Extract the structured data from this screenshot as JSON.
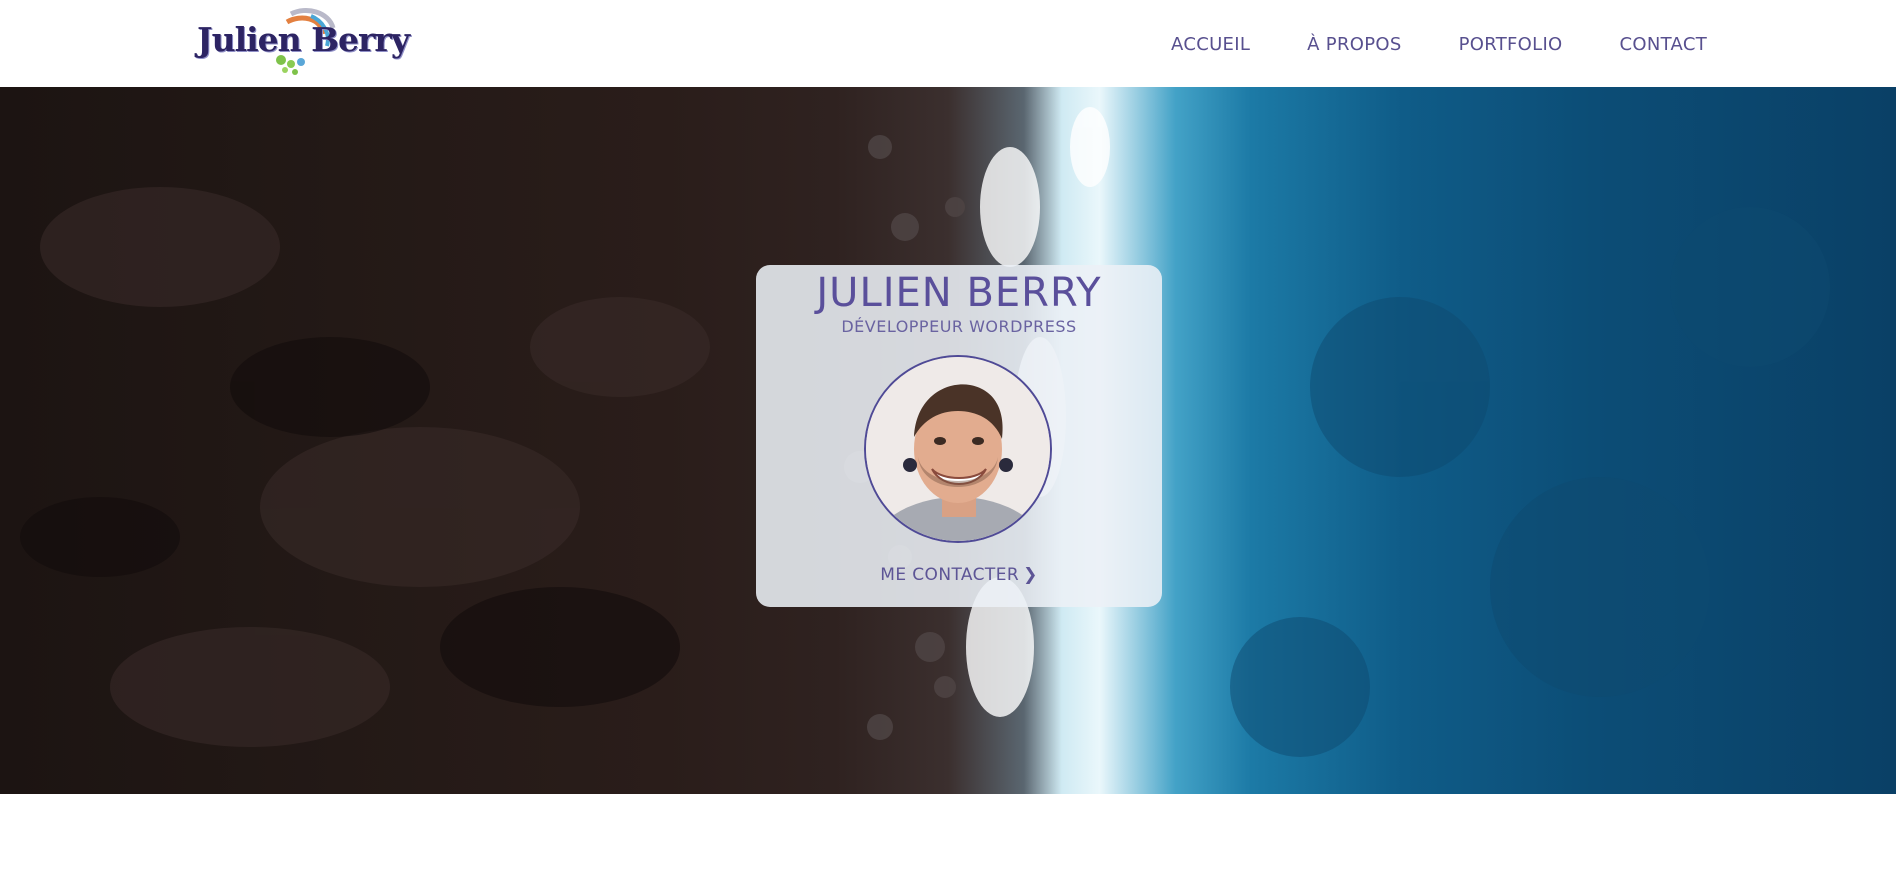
{
  "header": {
    "logo": {
      "text": "Julien Berry",
      "icon": "swirl-logo-icon"
    },
    "nav": [
      {
        "label": "ACCUEIL"
      },
      {
        "label": "À PROPOS"
      },
      {
        "label": "PORTFOLIO"
      },
      {
        "label": "CONTACT"
      }
    ]
  },
  "hero": {
    "name": "JULIEN BERRY",
    "role": "DÉVELOPPEUR WORDPRESS",
    "avatar_icon": "profile-photo",
    "cta_label": "ME CONTACTER",
    "cta_icon": "chevron-right-icon"
  },
  "colors": {
    "accent": "#5a4f9b",
    "nav_text": "#58508f",
    "card_bg": "#ecf0f6"
  }
}
